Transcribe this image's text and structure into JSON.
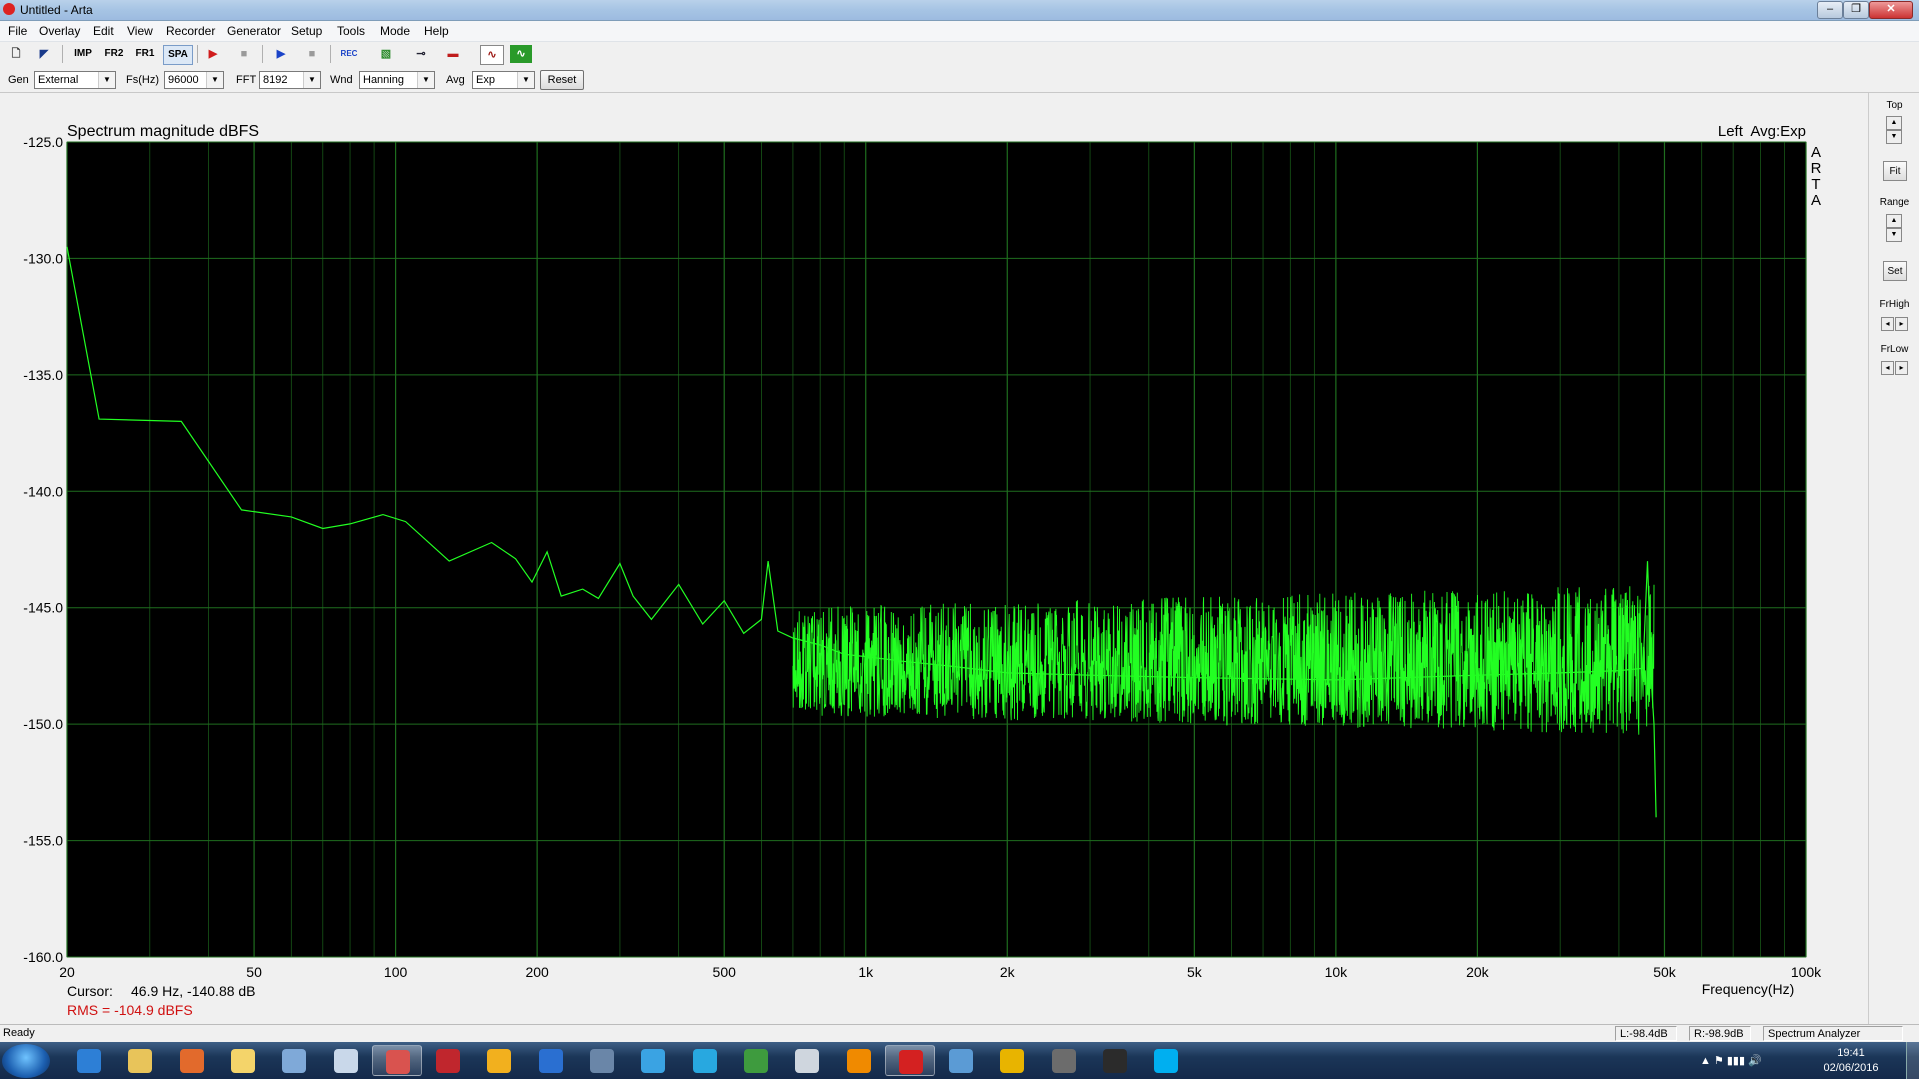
{
  "window": {
    "title": "Untitled - Arta",
    "controls": [
      "–",
      "❐",
      "✕"
    ]
  },
  "menu": [
    "File",
    "Overlay",
    "Edit",
    "View",
    "Recorder",
    "Generator",
    "Setup",
    "Tools",
    "Mode",
    "Help"
  ],
  "toolbar": {
    "buttons": [
      {
        "name": "new-icon",
        "glyph": "🗋"
      },
      {
        "name": "open-icon",
        "glyph": "◤"
      },
      {
        "name": "imp-mode",
        "glyph": "IMP"
      },
      {
        "name": "fr2-mode",
        "glyph": "FR2"
      },
      {
        "name": "fr1-mode",
        "glyph": "FR1"
      },
      {
        "name": "spa-mode",
        "glyph": "SPA"
      },
      {
        "name": "record-icon",
        "glyph": "▶"
      },
      {
        "name": "stop-icon",
        "glyph": "■"
      },
      {
        "name": "play-icon",
        "glyph": "▶"
      },
      {
        "name": "stop2-icon",
        "glyph": "■"
      },
      {
        "name": "rec-file-icon",
        "glyph": "REC"
      },
      {
        "name": "overlay-icon",
        "glyph": "▧"
      },
      {
        "name": "probe-icon",
        "glyph": "⊸"
      },
      {
        "name": "flag-icon",
        "glyph": "▬"
      },
      {
        "name": "scope-icon",
        "glyph": "∿"
      },
      {
        "name": "meter-icon",
        "glyph": "∿"
      }
    ]
  },
  "settings": {
    "gen_label": "Gen",
    "gen_value": "External",
    "fs_label": "Fs(Hz)",
    "fs_value": "96000",
    "fft_label": "FFT",
    "fft_value": "8192",
    "wnd_label": "Wnd",
    "wnd_value": "Hanning",
    "avg_label": "Avg",
    "avg_value": "Exp",
    "reset_label": "Reset"
  },
  "chart_data": {
    "type": "line",
    "title": "Spectrum magnitude dBFS",
    "channel_label": "Left  Avg:Exp",
    "brand": [
      "A",
      "R",
      "T",
      "A"
    ],
    "xlabel": "Frequency(Hz)",
    "x_scale": "log",
    "xlim": [
      20,
      100000
    ],
    "ylim": [
      -160,
      -125
    ],
    "x_ticks": [
      20,
      50,
      100,
      200,
      500,
      1000,
      2000,
      5000,
      10000,
      20000,
      50000,
      100000
    ],
    "x_tick_labels": [
      "20",
      "50",
      "100",
      "200",
      "500",
      "1k",
      "2k",
      "5k",
      "10k",
      "20k",
      "50k",
      "100k"
    ],
    "y_ticks": [
      -125,
      -130,
      -135,
      -140,
      -145,
      -150,
      -155,
      -160
    ],
    "y_tick_labels": [
      "-125.0",
      "-130.0",
      "-135.0",
      "-140.0",
      "-145.0",
      "-150.0",
      "-155.0",
      "-160.0"
    ],
    "grid": true,
    "background": "#000000",
    "grid_color": "#1f6e1f",
    "trace_color": "#22ff22",
    "series": [
      {
        "x": [
          20,
          23.4,
          35,
          47,
          60,
          70,
          80,
          94,
          105,
          130,
          160,
          180,
          195,
          210,
          225,
          250,
          270,
          300,
          320,
          350,
          400,
          450,
          500,
          550,
          600,
          620,
          650,
          700,
          800,
          900,
          1000,
          1200,
          1500,
          2000,
          3000,
          5000,
          10000,
          20000,
          30000,
          40000,
          45000,
          46000,
          47000,
          47500,
          48000
        ],
        "y": [
          -129.5,
          -136.9,
          -137.0,
          -140.8,
          -141.1,
          -141.6,
          -141.4,
          -141.0,
          -141.3,
          -143.0,
          -142.2,
          -142.9,
          -143.9,
          -142.6,
          -144.5,
          -144.2,
          -144.6,
          -143.1,
          -144.5,
          -145.5,
          -144.0,
          -145.7,
          -144.7,
          -146.1,
          -145.5,
          -143.0,
          -146.0,
          -146.3,
          -146.6,
          -147.0,
          -147.1,
          -147.3,
          -147.5,
          -147.8,
          -147.9,
          -148.0,
          -148.1,
          -147.9,
          -147.8,
          -147.7,
          -147.6,
          -143.0,
          -148.5,
          -150.0,
          -154.0
        ]
      }
    ],
    "noise_band": {
      "from_hz": 700,
      "to_hz": 47500,
      "center_db": -147.5,
      "spread_db_low": 2.5,
      "spread_db_high": 3.5
    }
  },
  "cursor": {
    "label": "Cursor:",
    "value": "46.9 Hz, -140.88 dB"
  },
  "rms": "RMS = -104.9 dBFS",
  "right_panel": {
    "top_label": "Top",
    "fit_label": "Fit",
    "range_label": "Range",
    "set_label": "Set",
    "frhigh_label": "FrHigh",
    "frlow_label": "FrLow"
  },
  "status": {
    "ready": "Ready",
    "left_level": "L:-98.4dB",
    "right_level": "R:-98.9dB",
    "mode": "Spectrum Analyzer"
  },
  "taskbar": {
    "apps": [
      {
        "name": "internet-explorer-icon",
        "color": "#2d7fd6"
      },
      {
        "name": "file-explorer-icon",
        "color": "#e8c45a"
      },
      {
        "name": "media-player-icon",
        "color": "#e26a2c"
      },
      {
        "name": "folder-icon",
        "color": "#f4d46a"
      },
      {
        "name": "calculator-icon",
        "color": "#7fa9d8"
      },
      {
        "name": "notepad-icon",
        "color": "#c9d8ea"
      },
      {
        "name": "paint-icon",
        "color": "#d9534f",
        "active": true
      },
      {
        "name": "acrobat-icon",
        "color": "#c0262d"
      },
      {
        "name": "winamp-icon",
        "color": "#f2b01e"
      },
      {
        "name": "google-earth-icon",
        "color": "#2a6fd1"
      },
      {
        "name": "audio-tool-icon",
        "color": "#6a86a8"
      },
      {
        "name": "quicktime-icon",
        "color": "#3aa3e3"
      },
      {
        "name": "kodi-icon",
        "color": "#28a8e0"
      },
      {
        "name": "excel-icon",
        "color": "#3e9b3e"
      },
      {
        "name": "document-icon",
        "color": "#cfd6de"
      },
      {
        "name": "vlc-icon",
        "color": "#f08a00"
      },
      {
        "name": "arta-icon",
        "color": "#d42121",
        "active": true
      },
      {
        "name": "network-icon",
        "color": "#5b9bd5"
      },
      {
        "name": "chrome-icon",
        "color": "#e8b400"
      },
      {
        "name": "id-icon",
        "color": "#6c6c6c"
      },
      {
        "name": "tascam-icon",
        "color": "#2b2b2b"
      },
      {
        "name": "skype-icon",
        "color": "#00aff0"
      }
    ],
    "time": "19:41",
    "date": "02/06/2016"
  }
}
